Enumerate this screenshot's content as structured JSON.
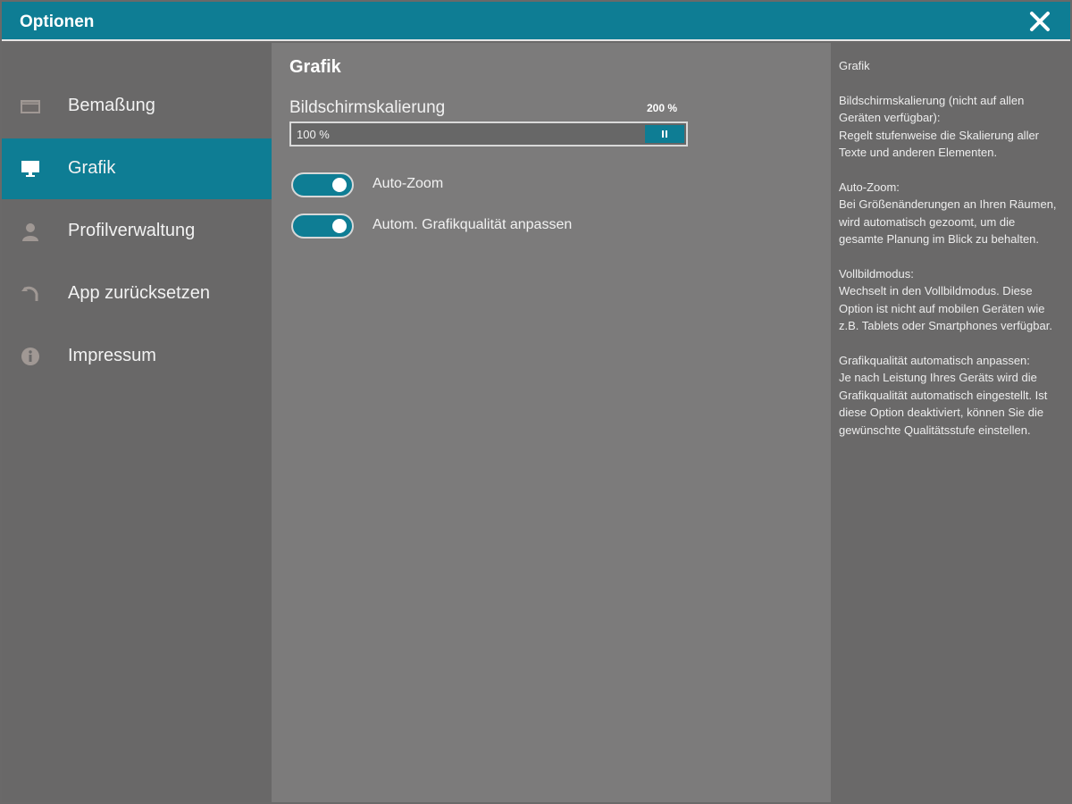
{
  "window": {
    "title": "Optionen",
    "close_icon": "close-icon",
    "accent_color": "#0e7d94"
  },
  "sidebar": {
    "items": [
      {
        "label": "Bemaßung",
        "icon": "ruler-icon",
        "active": false
      },
      {
        "label": "Grafik",
        "icon": "monitor-icon",
        "active": true
      },
      {
        "label": "Profilverwaltung",
        "icon": "user-icon",
        "active": false
      },
      {
        "label": "App zurücksetzen",
        "icon": "reset-icon",
        "active": false
      },
      {
        "label": "Impressum",
        "icon": "info-icon",
        "active": false
      }
    ]
  },
  "main": {
    "section_title": "Grafik",
    "scaling": {
      "label": "Bildschirmskalierung",
      "current_value": "100 %",
      "max_value": "200 %"
    },
    "toggles": [
      {
        "label": "Auto-Zoom",
        "on": true
      },
      {
        "label": "Autom. Grafikqualität anpassen",
        "on": true
      }
    ]
  },
  "help": {
    "text": "Grafik\n\nBildschirmskalierung (nicht auf allen Geräten verfügbar):\nRegelt stufenweise die Skalierung aller Texte und anderen Elementen.\n\nAuto-Zoom:\nBei Größenänderungen an Ihren Räumen, wird automatisch gezoomt, um die gesamte Planung im Blick zu behalten.\n\nVollbildmodus:\nWechselt in den Vollbildmodus. Diese Option ist nicht auf mobilen Geräten wie z.B. Tablets oder Smartphones verfügbar.\n\nGrafikqualität automatisch anpassen:\nJe nach Leistung Ihres Geräts wird die Grafikqualität automatisch eingestellt. Ist diese Option deaktiviert, können Sie die gewünschte Qualitätsstufe einstellen."
  }
}
